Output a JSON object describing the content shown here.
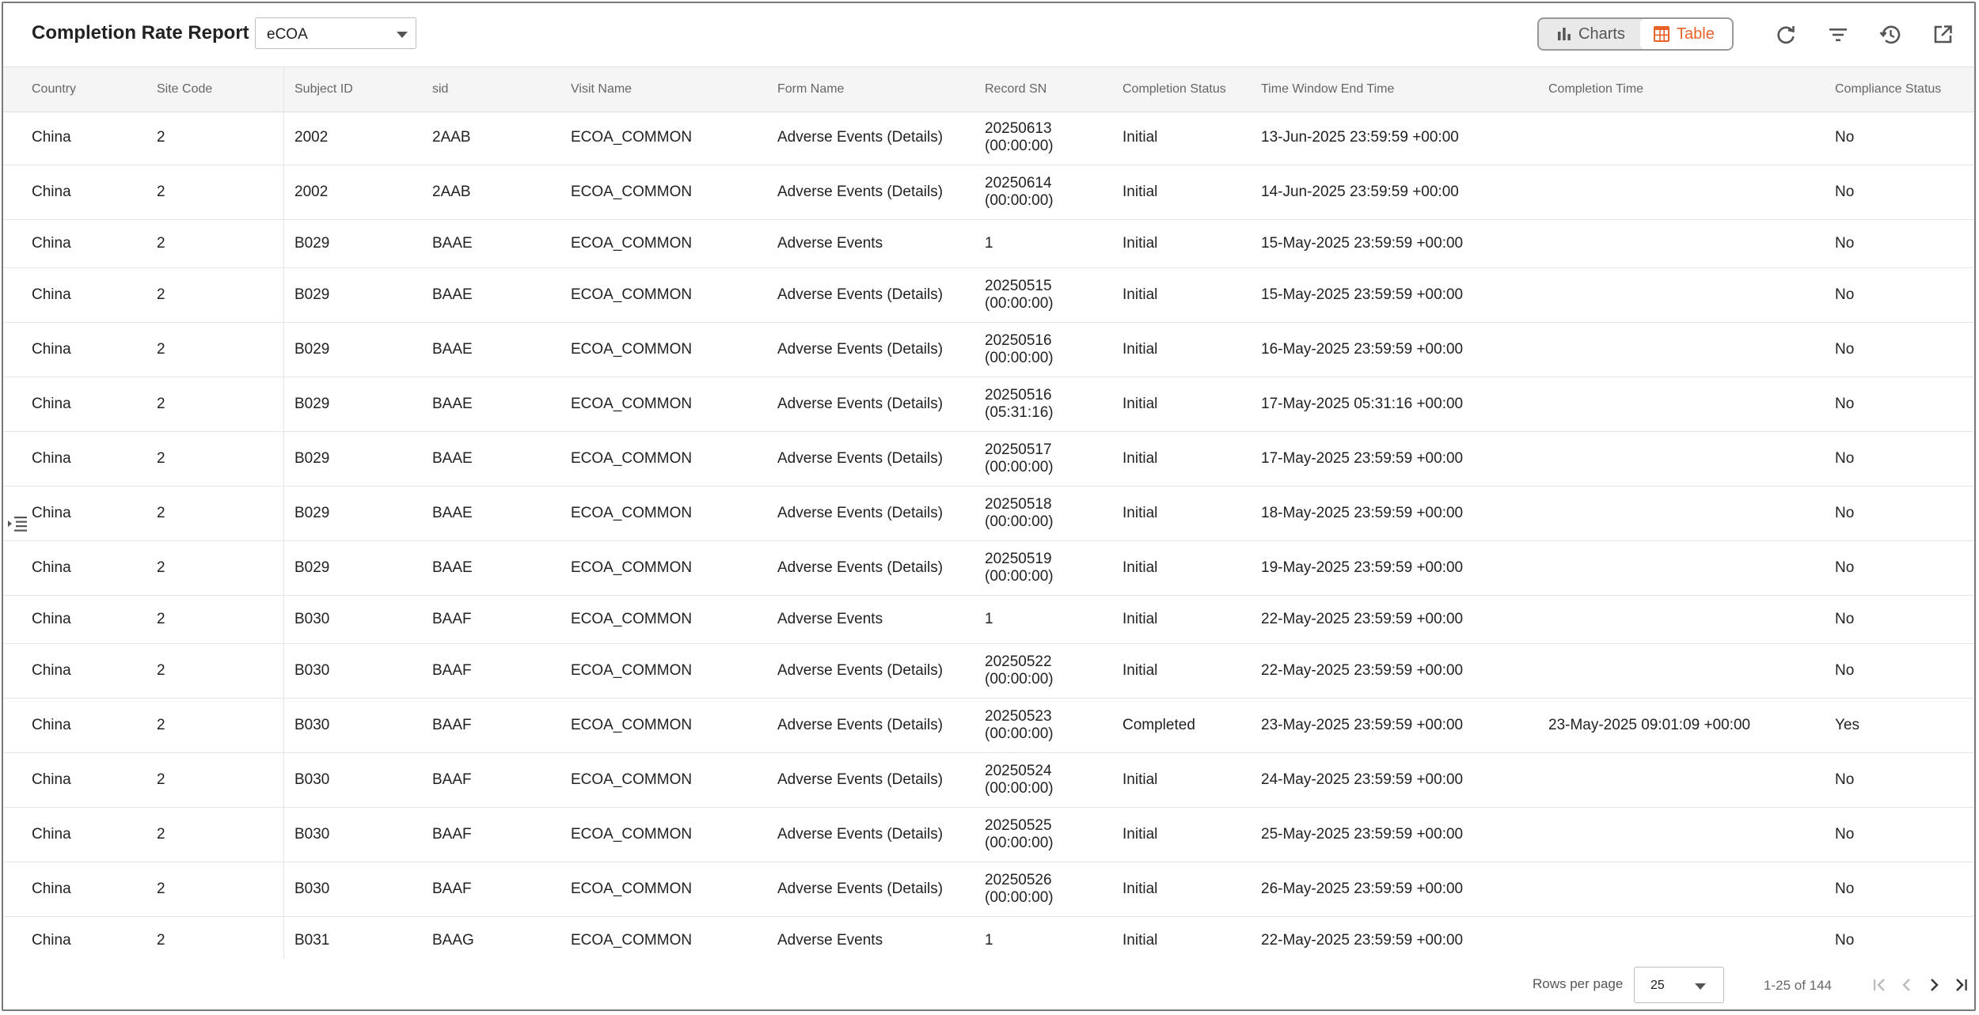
{
  "header": {
    "title": "Completion Rate Report",
    "module_select": {
      "value": "eCOA"
    },
    "view_toggle": {
      "charts_label": "Charts",
      "table_label": "Table",
      "active": "Table"
    },
    "actions": [
      "refresh-icon",
      "filter-icon",
      "history-icon",
      "open-external-icon"
    ]
  },
  "colors": {
    "accent": "#e8622a",
    "header_bg": "#f5f5f5"
  },
  "table": {
    "columns": [
      "Country",
      "Site Code",
      "Subject ID",
      "sid",
      "Visit Name",
      "Form Name",
      "Record SN",
      "Completion Status",
      "Time Window End Time",
      "Completion Time",
      "Compliance Status"
    ],
    "rows": [
      [
        "China",
        "2",
        "2002",
        "2AAB",
        "ECOA_COMMON",
        "Adverse Events (Details)",
        "20250613\n(00:00:00)",
        "Initial",
        "13-Jun-2025 23:59:59 +00:00",
        "",
        "No"
      ],
      [
        "China",
        "2",
        "2002",
        "2AAB",
        "ECOA_COMMON",
        "Adverse Events (Details)",
        "20250614\n(00:00:00)",
        "Initial",
        "14-Jun-2025 23:59:59 +00:00",
        "",
        "No"
      ],
      [
        "China",
        "2",
        "B029",
        "BAAE",
        "ECOA_COMMON",
        "Adverse Events",
        "1",
        "Initial",
        "15-May-2025 23:59:59 +00:00",
        "",
        "No"
      ],
      [
        "China",
        "2",
        "B029",
        "BAAE",
        "ECOA_COMMON",
        "Adverse Events (Details)",
        "20250515\n(00:00:00)",
        "Initial",
        "15-May-2025 23:59:59 +00:00",
        "",
        "No"
      ],
      [
        "China",
        "2",
        "B029",
        "BAAE",
        "ECOA_COMMON",
        "Adverse Events (Details)",
        "20250516\n(00:00:00)",
        "Initial",
        "16-May-2025 23:59:59 +00:00",
        "",
        "No"
      ],
      [
        "China",
        "2",
        "B029",
        "BAAE",
        "ECOA_COMMON",
        "Adverse Events (Details)",
        "20250516\n(05:31:16)",
        "Initial",
        "17-May-2025 05:31:16 +00:00",
        "",
        "No"
      ],
      [
        "China",
        "2",
        "B029",
        "BAAE",
        "ECOA_COMMON",
        "Adverse Events (Details)",
        "20250517\n(00:00:00)",
        "Initial",
        "17-May-2025 23:59:59 +00:00",
        "",
        "No"
      ],
      [
        "China",
        "2",
        "B029",
        "BAAE",
        "ECOA_COMMON",
        "Adverse Events (Details)",
        "20250518\n(00:00:00)",
        "Initial",
        "18-May-2025 23:59:59 +00:00",
        "",
        "No"
      ],
      [
        "China",
        "2",
        "B029",
        "BAAE",
        "ECOA_COMMON",
        "Adverse Events (Details)",
        "20250519\n(00:00:00)",
        "Initial",
        "19-May-2025 23:59:59 +00:00",
        "",
        "No"
      ],
      [
        "China",
        "2",
        "B030",
        "BAAF",
        "ECOA_COMMON",
        "Adverse Events",
        "1",
        "Initial",
        "22-May-2025 23:59:59 +00:00",
        "",
        "No"
      ],
      [
        "China",
        "2",
        "B030",
        "BAAF",
        "ECOA_COMMON",
        "Adverse Events (Details)",
        "20250522\n(00:00:00)",
        "Initial",
        "22-May-2025 23:59:59 +00:00",
        "",
        "No"
      ],
      [
        "China",
        "2",
        "B030",
        "BAAF",
        "ECOA_COMMON",
        "Adverse Events (Details)",
        "20250523\n(00:00:00)",
        "Completed",
        "23-May-2025 23:59:59 +00:00",
        "23-May-2025 09:01:09 +00:00",
        "Yes"
      ],
      [
        "China",
        "2",
        "B030",
        "BAAF",
        "ECOA_COMMON",
        "Adverse Events (Details)",
        "20250524\n(00:00:00)",
        "Initial",
        "24-May-2025 23:59:59 +00:00",
        "",
        "No"
      ],
      [
        "China",
        "2",
        "B030",
        "BAAF",
        "ECOA_COMMON",
        "Adverse Events (Details)",
        "20250525\n(00:00:00)",
        "Initial",
        "25-May-2025 23:59:59 +00:00",
        "",
        "No"
      ],
      [
        "China",
        "2",
        "B030",
        "BAAF",
        "ECOA_COMMON",
        "Adverse Events (Details)",
        "20250526\n(00:00:00)",
        "Initial",
        "26-May-2025 23:59:59 +00:00",
        "",
        "No"
      ],
      [
        "China",
        "2",
        "B031",
        "BAAG",
        "ECOA_COMMON",
        "Adverse Events",
        "1",
        "Initial",
        "22-May-2025 23:59:59 +00:00",
        "",
        "No"
      ]
    ]
  },
  "footer": {
    "rows_per_page_label": "Rows per page",
    "rows_per_page_value": "25",
    "range_label": "1-25 of 144"
  }
}
